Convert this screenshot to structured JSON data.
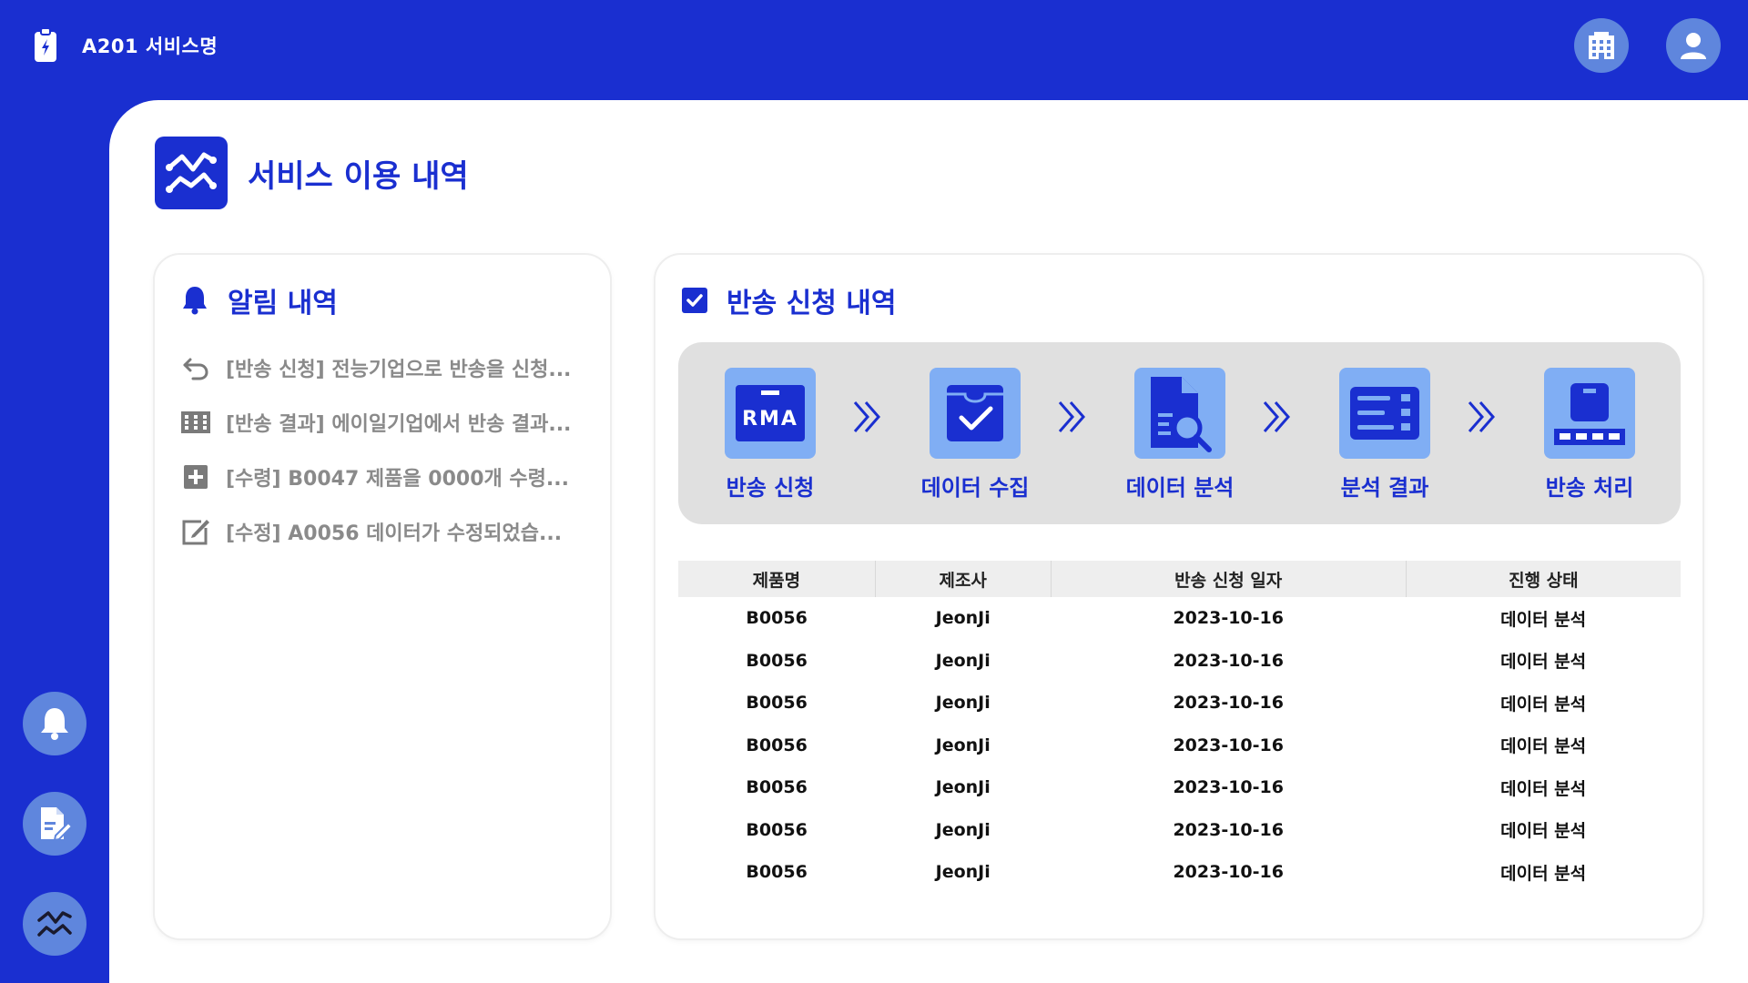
{
  "app": {
    "name": "A201 서비스명"
  },
  "page": {
    "title": "서비스 이용 내역"
  },
  "notifications": {
    "title": "알림 내역",
    "items": [
      {
        "icon": "return-arrow-icon",
        "text": "[반송 신청] 전능기업으로 반송을 신청..."
      },
      {
        "icon": "building-icon",
        "text": "[반송 결과] 에이일기업에서 반송 결과..."
      },
      {
        "icon": "plus-box-icon",
        "text": "[수령] B0047 제품을 0000개 수령..."
      },
      {
        "icon": "edit-icon",
        "text": "[수정] A0056 데이터가 수정되었습..."
      }
    ]
  },
  "returns": {
    "title": "반송 신청 내역",
    "steps": [
      {
        "label": "반송 신청",
        "icon": "rma-icon",
        "badge": "RMA"
      },
      {
        "label": "데이터 수집",
        "icon": "inbox-check-icon"
      },
      {
        "label": "데이터 분석",
        "icon": "document-search-icon"
      },
      {
        "label": "분석 결과",
        "icon": "result-list-icon"
      },
      {
        "label": "반송 처리",
        "icon": "conveyor-box-icon"
      }
    ],
    "table": {
      "headers": [
        "제품명",
        "제조사",
        "반송 신청 일자",
        "진행 상태"
      ],
      "rows": [
        [
          "B0056",
          "JeonJi",
          "2023-10-16",
          "데이터 분석"
        ],
        [
          "B0056",
          "JeonJi",
          "2023-10-16",
          "데이터 분석"
        ],
        [
          "B0056",
          "JeonJi",
          "2023-10-16",
          "데이터 분석"
        ],
        [
          "B0056",
          "JeonJi",
          "2023-10-16",
          "데이터 분석"
        ],
        [
          "B0056",
          "JeonJi",
          "2023-10-16",
          "데이터 분석"
        ],
        [
          "B0056",
          "JeonJi",
          "2023-10-16",
          "데이터 분석"
        ],
        [
          "B0056",
          "JeonJi",
          "2023-10-16",
          "데이터 분석"
        ]
      ]
    }
  },
  "colors": {
    "primary": "#1a2fd0",
    "icon_button": "#5f86dd",
    "step_box": "#80aef4",
    "process_bg": "#e0e0e0",
    "muted_text": "#8a8a8a"
  }
}
